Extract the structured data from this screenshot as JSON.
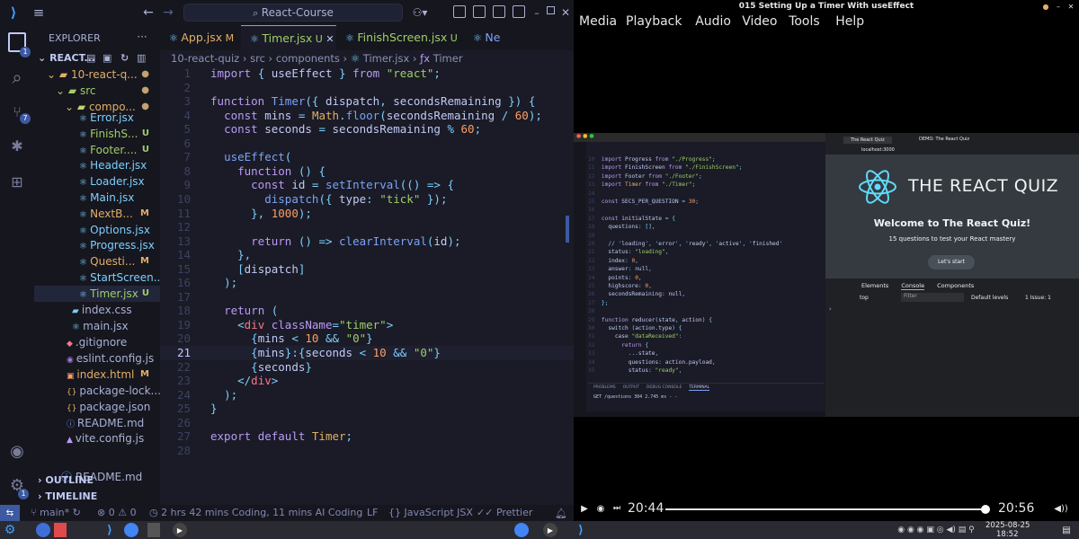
{
  "vscode": {
    "search_title": "React-Course",
    "explorer_title": "EXPLORER",
    "project_root": "REACT...",
    "folder_quiz": "10-react-q...",
    "folder_src": "src",
    "folder_components": "compo...",
    "files": [
      {
        "name": "Error.jsx",
        "status": "",
        "color": "#7dcfff"
      },
      {
        "name": "FinishS...",
        "status": "U",
        "color": "#9ece6a"
      },
      {
        "name": "Footer....",
        "status": "U",
        "color": "#9ece6a"
      },
      {
        "name": "Header.jsx",
        "status": "",
        "color": "#7dcfff"
      },
      {
        "name": "Loader.jsx",
        "status": "",
        "color": "#7dcfff"
      },
      {
        "name": "Main.jsx",
        "status": "",
        "color": "#7dcfff"
      },
      {
        "name": "NextB...",
        "status": "M",
        "color": "#e0af68"
      },
      {
        "name": "Options.jsx",
        "status": "",
        "color": "#7dcfff"
      },
      {
        "name": "Progress.jsx",
        "status": "",
        "color": "#7dcfff"
      },
      {
        "name": "Questi...",
        "status": "M",
        "color": "#e0af68"
      },
      {
        "name": "StartScreen...",
        "status": "",
        "color": "#7dcfff"
      },
      {
        "name": "Timer.jsx",
        "status": "U",
        "color": "#9ece6a"
      }
    ],
    "src_files": [
      {
        "name": "index.css",
        "status": ""
      },
      {
        "name": "main.jsx",
        "status": ""
      }
    ],
    "root_files": [
      {
        "name": ".gitignore",
        "status": ""
      },
      {
        "name": "eslint.config.js",
        "status": ""
      },
      {
        "name": "index.html",
        "status": "M"
      },
      {
        "name": "package-lock...",
        "status": ""
      },
      {
        "name": "package.json",
        "status": ""
      },
      {
        "name": "README.md",
        "status": ""
      },
      {
        "name": "vite.config.js",
        "status": ""
      }
    ],
    "outer_readme": "README.md",
    "outline_label": "OUTLINE",
    "timeline_label": "TIMELINE",
    "tabs": [
      {
        "label": "App.jsx",
        "status": "M"
      },
      {
        "label": "Timer.jsx",
        "status": "U"
      },
      {
        "label": "FinishScreen.jsx",
        "status": "U"
      },
      {
        "label": "Ne",
        "status": ""
      }
    ],
    "breadcrumb": [
      "10-react-quiz",
      "src",
      "components",
      "Timer.jsx",
      "Timer"
    ],
    "current_line": 21,
    "code": [
      "import { useEffect } from \"react\";",
      "",
      "function Timer({ dispatch, secondsRemaining }) {",
      "  const mins = Math.floor(secondsRemaining / 60);",
      "  const seconds = secondsRemaining % 60;",
      "",
      "  useEffect(",
      "    function () {",
      "      const id = setInterval(() => {",
      "        dispatch({ type: \"tick\" });",
      "      }, 1000);",
      "",
      "      return () => clearInterval(id);",
      "    },",
      "    [dispatch]",
      "  );",
      "",
      "  return (",
      "    <div className=\"timer\">",
      "      {mins < 10 && \"0\"}",
      "      {mins}:{seconds < 10 && \"0\"}",
      "      {seconds}",
      "    </div>",
      "  );",
      "}",
      "",
      "export default Timer;",
      ""
    ],
    "status": {
      "branch": "main*",
      "errors": "0",
      "warnings": "0",
      "coding_time": "2 hrs 42 mins Coding, 11 mins AI Coding",
      "eol": "LF",
      "language": "JavaScript JSX",
      "formatter": "Prettier"
    },
    "badges": {
      "source_control": "7",
      "accounts": "1",
      "explorer": "1"
    }
  },
  "player": {
    "window_title": "015 Setting Up a Timer With useEffect",
    "menu": [
      "Media",
      "Playback",
      "Audio",
      "Video",
      "Tools",
      "Help"
    ],
    "time_current": "20:44",
    "time_total": "20:56",
    "progress": 0.99,
    "inner": {
      "app_title": "THE REACT QUIZ",
      "welcome": "Welcome to The React Quiz!",
      "subtitle": "15 questions to test your React mastery",
      "start_button": "Let's start",
      "browser_tab1": "The React Quiz",
      "browser_tab2": "DEMO: The React Quiz",
      "url": "localhost:3000",
      "devtools_tabs": [
        "Elements",
        "Console",
        "Components"
      ],
      "filter_placeholder": "Filter",
      "default_levels": "Default levels",
      "issues": "1 Issue: 1",
      "top_label": "top",
      "terminal_tabs": [
        "PROBLEMS",
        "OUTPUT",
        "DEBUG CONSOLE",
        "TERMINAL"
      ],
      "terminal_line": "GET /questions 304 2.745 ms - -",
      "inner_code": [
        "import Progress from \"./Progress\";",
        "import FinishScreen from \"./FinishScreen\";",
        "import Footer from \"./Footer\";",
        "import Timer from \"./Timer\";",
        "",
        "const SECS_PER_QUESTION = 30;",
        "",
        "const initialState = {",
        "  questions: [],",
        "",
        "  // 'loading', 'error', 'ready', 'active', 'finished'",
        "  status: \"loading\",",
        "  index: 0,",
        "  answer: null,",
        "  points: 0,",
        "  highscore: 0,",
        "  secondsRemaining: null,",
        "};",
        "",
        "function reducer(state, action) {",
        "  switch (action.type) {",
        "    case \"dataReceived\":",
        "      return {",
        "        ...state,",
        "        questions: action.payload,",
        "        status: \"ready\","
      ]
    }
  },
  "taskbar": {
    "date": "2025-08-25",
    "time": "18:52"
  }
}
